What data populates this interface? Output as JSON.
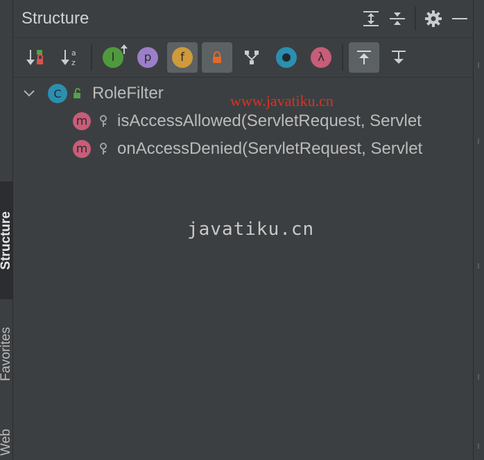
{
  "header": {
    "title": "Structure",
    "buttons": [
      "expand-all",
      "collapse-all",
      "settings",
      "hide"
    ]
  },
  "toolbar": {
    "buttons": [
      {
        "name": "sort-by-visibility",
        "pressed": false
      },
      {
        "name": "sort-alphabetically",
        "pressed": false
      },
      {
        "name": "show-inherited",
        "pressed": false,
        "glyph": "I"
      },
      {
        "name": "show-properties",
        "pressed": false,
        "glyph": "p"
      },
      {
        "name": "show-fields",
        "pressed": true,
        "glyph": "f"
      },
      {
        "name": "show-non-public",
        "pressed": true
      },
      {
        "name": "show-inherited-from-object",
        "pressed": false
      },
      {
        "name": "show-anonymous",
        "pressed": false
      },
      {
        "name": "show-lambdas",
        "pressed": false,
        "glyph": "λ"
      },
      {
        "name": "autoscroll-to-source",
        "pressed": true
      },
      {
        "name": "autoscroll-from-source",
        "pressed": false
      }
    ]
  },
  "tree": {
    "class_name": "RoleFilter",
    "class_badge": "C",
    "method_badge": "m",
    "methods": [
      "isAccessAllowed(ServletRequest, Servlet",
      "onAccessDenied(ServletRequest, Servlet"
    ]
  },
  "left_strip": {
    "tabs": [
      "Structure",
      "Favorites",
      "Web"
    ]
  },
  "watermarks": {
    "red": "www.javatiku.cn",
    "mono": "javatiku.cn"
  },
  "colors": {
    "background": "#3c3f41",
    "method_badge": "#c75d79",
    "class_badge": "#2b8fb0",
    "inherited": "#4f9a3c",
    "property": "#9b7fc9",
    "field": "#cf9a3a",
    "lock": "#e06a2a",
    "lambda": "#c75d79"
  }
}
